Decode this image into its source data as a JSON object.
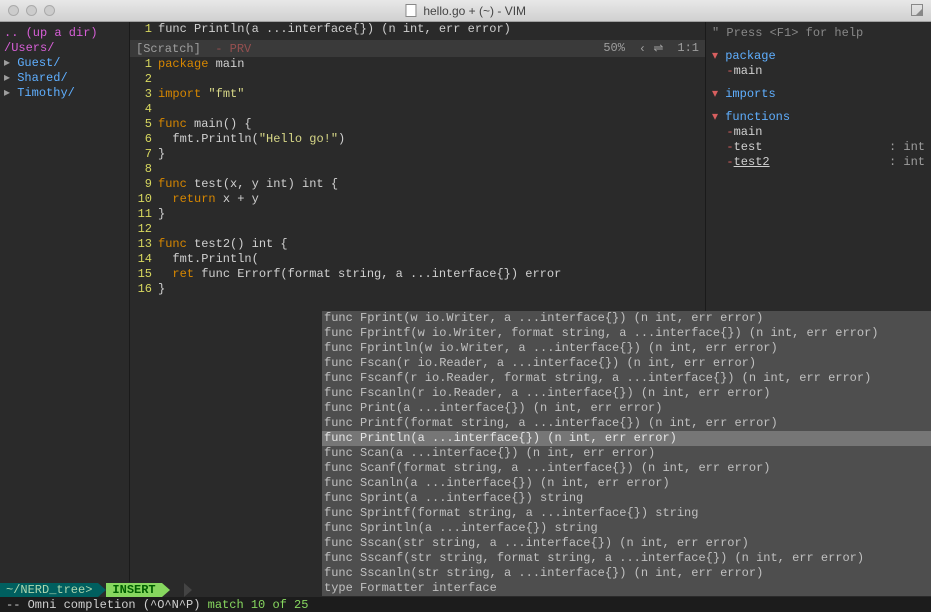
{
  "window": {
    "title": "hello.go + (~) - VIM"
  },
  "tree": {
    "up": ".. (up a dir)",
    "root": "/Users/",
    "items": [
      "Guest/",
      "Shared/",
      "Timothy/"
    ]
  },
  "top_buffer": {
    "line_no": "1",
    "code": "func Println(a ...interface{}) (n int, err error)"
  },
  "scratch_status": {
    "name": "[Scratch]",
    "flag": "- PRV",
    "percent": "50%",
    "sym": "‹ ⇌",
    "pos": "1:1"
  },
  "source": [
    {
      "n": "1",
      "tokens": [
        {
          "t": "package ",
          "c": "orange"
        },
        {
          "t": "main",
          "c": "white"
        }
      ]
    },
    {
      "n": "2",
      "tokens": []
    },
    {
      "n": "3",
      "tokens": [
        {
          "t": "import ",
          "c": "orange"
        },
        {
          "t": "\"fmt\"",
          "c": "yellow"
        }
      ]
    },
    {
      "n": "4",
      "tokens": []
    },
    {
      "n": "5",
      "tokens": [
        {
          "t": "func ",
          "c": "orange"
        },
        {
          "t": "main() {",
          "c": "white"
        }
      ]
    },
    {
      "n": "6",
      "tokens": [
        {
          "t": "  fmt.Println(",
          "c": "white"
        },
        {
          "t": "\"Hello go!\"",
          "c": "yellow"
        },
        {
          "t": ")",
          "c": "white"
        }
      ]
    },
    {
      "n": "7",
      "tokens": [
        {
          "t": "}",
          "c": "white"
        }
      ]
    },
    {
      "n": "8",
      "tokens": []
    },
    {
      "n": "9",
      "tokens": [
        {
          "t": "func ",
          "c": "orange"
        },
        {
          "t": "test(x, y int) int {",
          "c": "white"
        }
      ]
    },
    {
      "n": "10",
      "tokens": [
        {
          "t": "  ",
          "c": "white"
        },
        {
          "t": "return ",
          "c": "orange"
        },
        {
          "t": "x + y",
          "c": "white"
        }
      ]
    },
    {
      "n": "11",
      "tokens": [
        {
          "t": "}",
          "c": "white"
        }
      ]
    },
    {
      "n": "12",
      "tokens": []
    },
    {
      "n": "13",
      "tokens": [
        {
          "t": "func ",
          "c": "orange"
        },
        {
          "t": "test2() int {",
          "c": "white"
        }
      ]
    },
    {
      "n": "14",
      "tokens": [
        {
          "t": "  fmt.Println(",
          "c": "white"
        }
      ]
    },
    {
      "n": "15",
      "tokens": [
        {
          "t": "  ",
          "c": "white"
        },
        {
          "t": "ret ",
          "c": "orange"
        },
        {
          "t": "func Errorf(format string, a ...interface{}) error",
          "c": "white"
        }
      ]
    },
    {
      "n": "16",
      "tokens": [
        {
          "t": "}",
          "c": "white"
        }
      ]
    }
  ],
  "completion": {
    "selected_index": 8,
    "items": [
      "func Fprint(w io.Writer, a ...interface{}) (n int, err error)",
      "func Fprintf(w io.Writer, format string, a ...interface{}) (n int, err error)",
      "func Fprintln(w io.Writer, a ...interface{}) (n int, err error)",
      "func Fscan(r io.Reader, a ...interface{}) (n int, err error)",
      "func Fscanf(r io.Reader, format string, a ...interface{}) (n int, err error)",
      "func Fscanln(r io.Reader, a ...interface{}) (n int, err error)",
      "func Print(a ...interface{}) (n int, err error)",
      "func Printf(format string, a ...interface{}) (n int, err error)",
      "func Println(a ...interface{}) (n int, err error)",
      "func Scan(a ...interface{}) (n int, err error)",
      "func Scanf(format string, a ...interface{}) (n int, err error)",
      "func Scanln(a ...interface{}) (n int, err error)",
      "func Sprint(a ...interface{}) string",
      "func Sprintf(format string, a ...interface{}) string",
      "func Sprintln(a ...interface{}) string",
      "func Sscan(str string, a ...interface{}) (n int, err error)",
      "func Sscanf(str string, format string, a ...interface{}) (n int, err error)",
      "func Sscanln(str string, a ...interface{}) (n int, err error)",
      "type Formatter interface"
    ]
  },
  "tagbar": {
    "help": "\" Press <F1> for help",
    "sections": [
      {
        "title": "package",
        "items": [
          {
            "name": "main",
            "type": ""
          }
        ]
      },
      {
        "title": "imports",
        "items": []
      },
      {
        "title": "functions",
        "items": [
          {
            "name": "main",
            "type": ""
          },
          {
            "name": "test",
            "type": ": int"
          },
          {
            "name": "test2",
            "type": ": int",
            "underline": true
          }
        ]
      }
    ]
  },
  "statusline": {
    "nerd": "~/NERD_tree>",
    "mode": "INSERT",
    "warn": "",
    "msg_prefix": "-- Omni completion (^O^N^P) ",
    "msg_match": "match 10 of 25"
  }
}
